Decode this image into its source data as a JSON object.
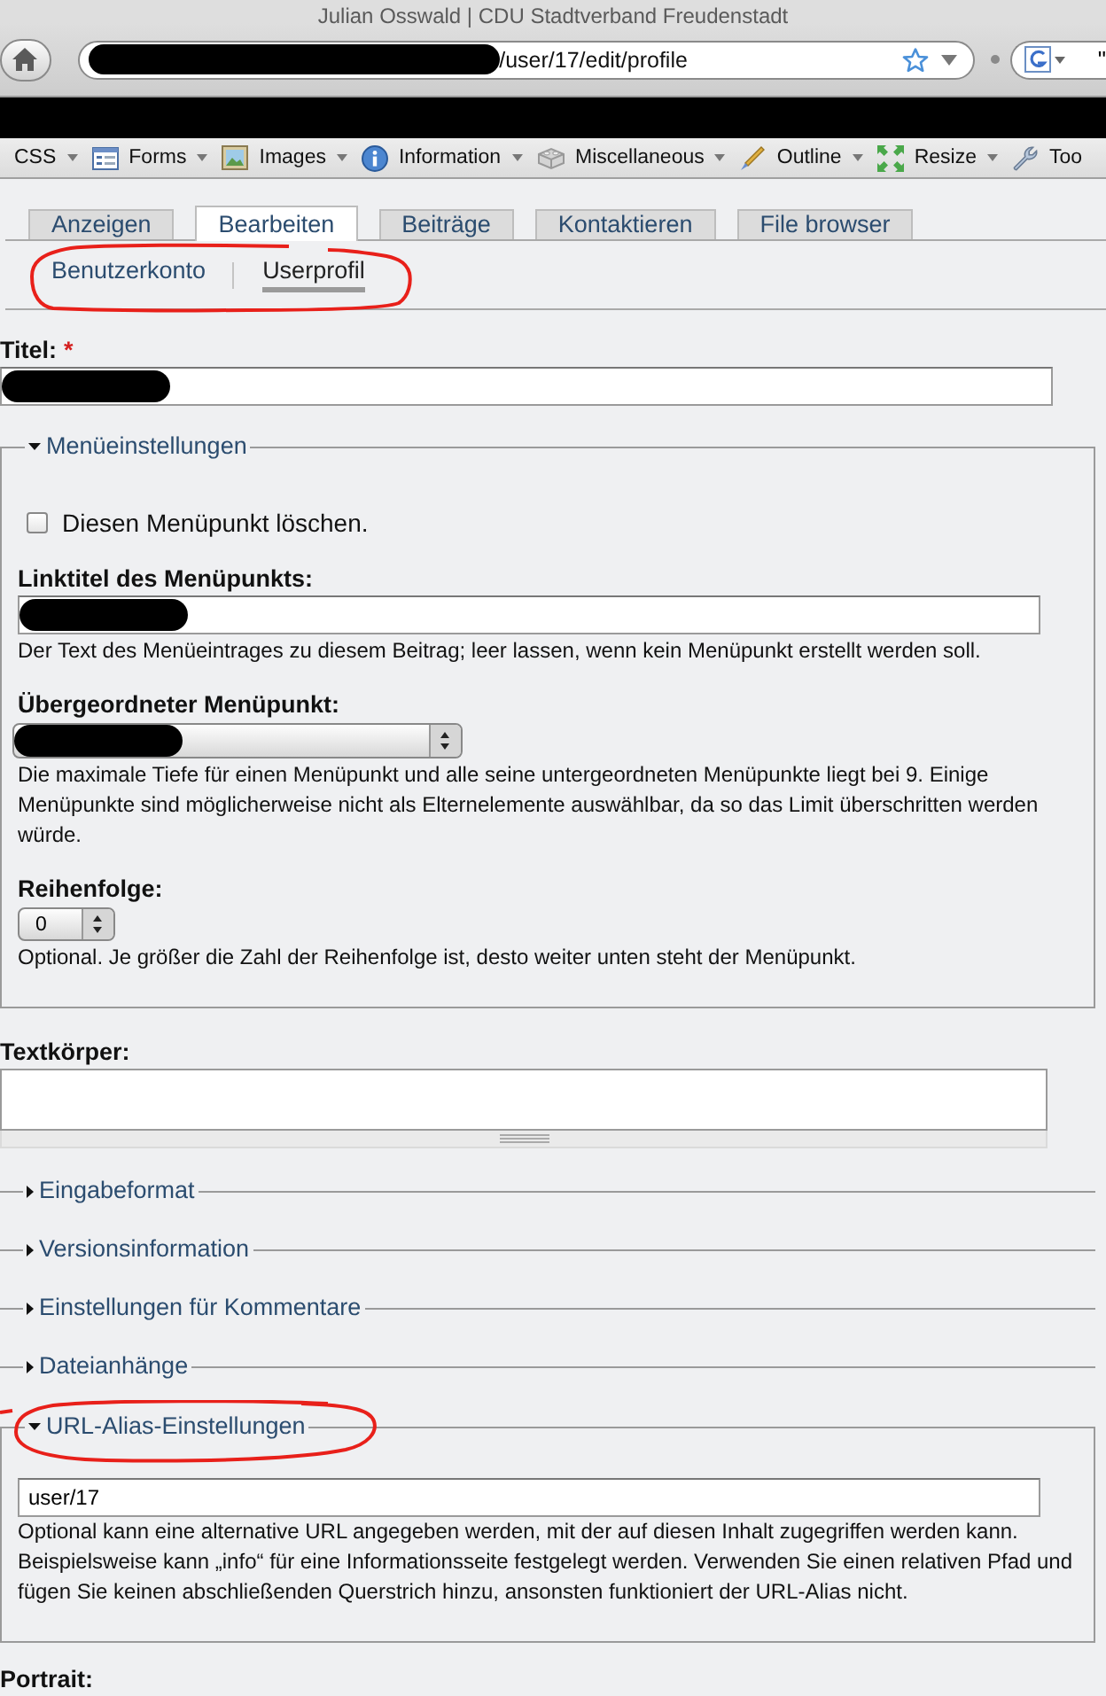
{
  "window": {
    "title": "Julian Osswald | CDU Stadtverband Freudenstadt"
  },
  "navigation_bar": {
    "address": {
      "redacted": true,
      "value": "/user/17/edit/profile"
    },
    "search": {
      "value": "\""
    }
  },
  "bookmarks_bar": {
    "redacted": true
  },
  "developer_toolbar": {
    "items": [
      {
        "label": "CSS",
        "dropdown": true
      },
      {
        "label": "Forms",
        "dropdown": true
      },
      {
        "label": "Images",
        "dropdown": true
      },
      {
        "label": "Information",
        "dropdown": true
      },
      {
        "label": "Miscellaneous",
        "dropdown": true
      },
      {
        "label": "Outline",
        "dropdown": true
      },
      {
        "label": "Resize",
        "dropdown": true
      },
      {
        "label": "Too"
      }
    ]
  },
  "tabs": [
    {
      "label": "Anzeigen",
      "selected": false
    },
    {
      "label": "Bearbeiten",
      "selected": true
    },
    {
      "label": "Beiträge",
      "selected": false
    },
    {
      "label": "Kontaktieren",
      "selected": false
    },
    {
      "label": "File browser",
      "selected": false
    }
  ],
  "secondary_tabs": {
    "circled": true,
    "items": [
      {
        "label": "Benutzerkonto",
        "selected": false
      },
      {
        "label": "Userprofil",
        "selected": true
      }
    ]
  },
  "title_field": {
    "label": "Titel:",
    "required_mark": "*",
    "redacted": true
  },
  "menu_settings": {
    "legend": "Menüeinstellungen",
    "expanded": true,
    "delete_checkbox": {
      "label": "Diesen Menüpunkt löschen.",
      "checked": false
    },
    "link_title": {
      "label": "Linktitel des Menüpunkts:",
      "redacted": true,
      "description": "Der Text des Menüeintrages zu diesem Beitrag; leer lassen, wenn kein Menüpunkt erstellt werden soll."
    },
    "parent_item": {
      "label": "Übergeordneter Menüpunkt:",
      "redacted": true,
      "description": "Die maximale Tiefe für einen Menüpunkt und alle seine untergeordneten Menüpunkte liegt bei 9. Einige Menüpunkte sind möglicherweise nicht als Elternelemente auswählbar, da so das Limit überschritten werden würde."
    },
    "weight": {
      "label": "Reihenfolge:",
      "value": "0",
      "description": "Optional. Je größer die Zahl der Reihenfolge ist, desto weiter unten steht der Menüpunkt."
    }
  },
  "body": {
    "label": "Textkörper:"
  },
  "collapsed_sections": [
    {
      "legend": "Eingabeformat",
      "expanded": false
    },
    {
      "legend": "Versionsinformation",
      "expanded": false
    },
    {
      "legend": "Einstellungen für Kommentare",
      "expanded": false
    },
    {
      "legend": "Dateianhänge",
      "expanded": false
    }
  ],
  "url_alias": {
    "legend": "URL-Alias-Einstellungen",
    "expanded": true,
    "circled": true,
    "value": "user/17",
    "description": "Optional kann eine alternative URL angegeben werden, mit der auf diesen Inhalt zugegriffen werden kann. Beispielsweise kann „info“ für eine Informationsseite festgelegt werden. Verwenden Sie einen relativen Pfad und fügen Sie keinen abschließenden Querstrich hinzu, ansonsten funktioniert der URL-Alias nicht."
  },
  "portrait": {
    "label": "Portrait:"
  }
}
